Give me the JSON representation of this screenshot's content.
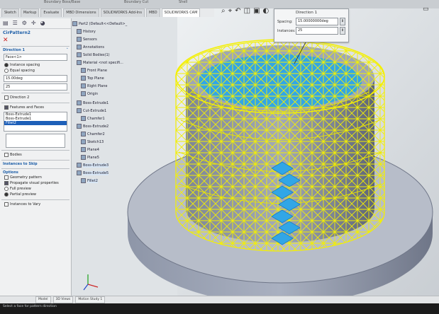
{
  "window": {
    "titles": [
      "Boundary Boss/Base",
      "Boundary Cut",
      "Shell"
    ]
  },
  "tabs": [
    "Sketch",
    "Markup",
    "Evaluate",
    "MBD Dimensions",
    "SOLIDWORKS Add-Ins",
    "MBD",
    "SOLIDWORKS CAM"
  ],
  "property_manager": {
    "title": "CirPattern2",
    "direction1_header": "Direction 1",
    "face_field": "Face<1>",
    "instance_spacing": "Instance spacing",
    "equal_spacing": "Equal spacing",
    "angle_value": "15.00deg",
    "instances_value": "25",
    "direction2_header": "Direction 2",
    "features_header": "Features and Faces",
    "features_list": [
      "Boss-Extrude1",
      "Boss-Extrude1",
      "Fillet2"
    ],
    "bodies_header": "Bodies",
    "instances_skip_header": "Instances to Skip",
    "options_header": "Options",
    "geometry_pattern": "Geometry pattern",
    "propagate": "Propagate visual properties",
    "full_preview": "Full preview",
    "partial_preview": "Partial preview",
    "instances_vary": "Instances to Vary"
  },
  "feature_tree": {
    "root": "Part2 (Default<<Default>_",
    "items": [
      "History",
      "Sensors",
      "Annotations",
      "Solid Bodies(1)",
      "Material <not specifi...",
      "Front Plane",
      "Top Plane",
      "Right Plane",
      "Origin",
      "Boss-Extrude1",
      "Cut-Extrude1",
      "Chamfer1",
      "Boss-Extrude2",
      "Chamfer2",
      "Sketch13",
      "Plane4",
      "Plane5",
      "Boss-Extrude3",
      "Boss-Extrude5",
      "Fillet2"
    ]
  },
  "direction_popup": {
    "title": "Direction 1",
    "spacing_label": "Spacing:",
    "spacing_value": "15.00000000deg",
    "instances_label": "Instances:",
    "instances_value": "25"
  },
  "bottom_tabs": [
    "Model",
    "3D Views",
    "Motion Study 1"
  ],
  "status": {
    "text": "Select a face for pattern direction"
  }
}
